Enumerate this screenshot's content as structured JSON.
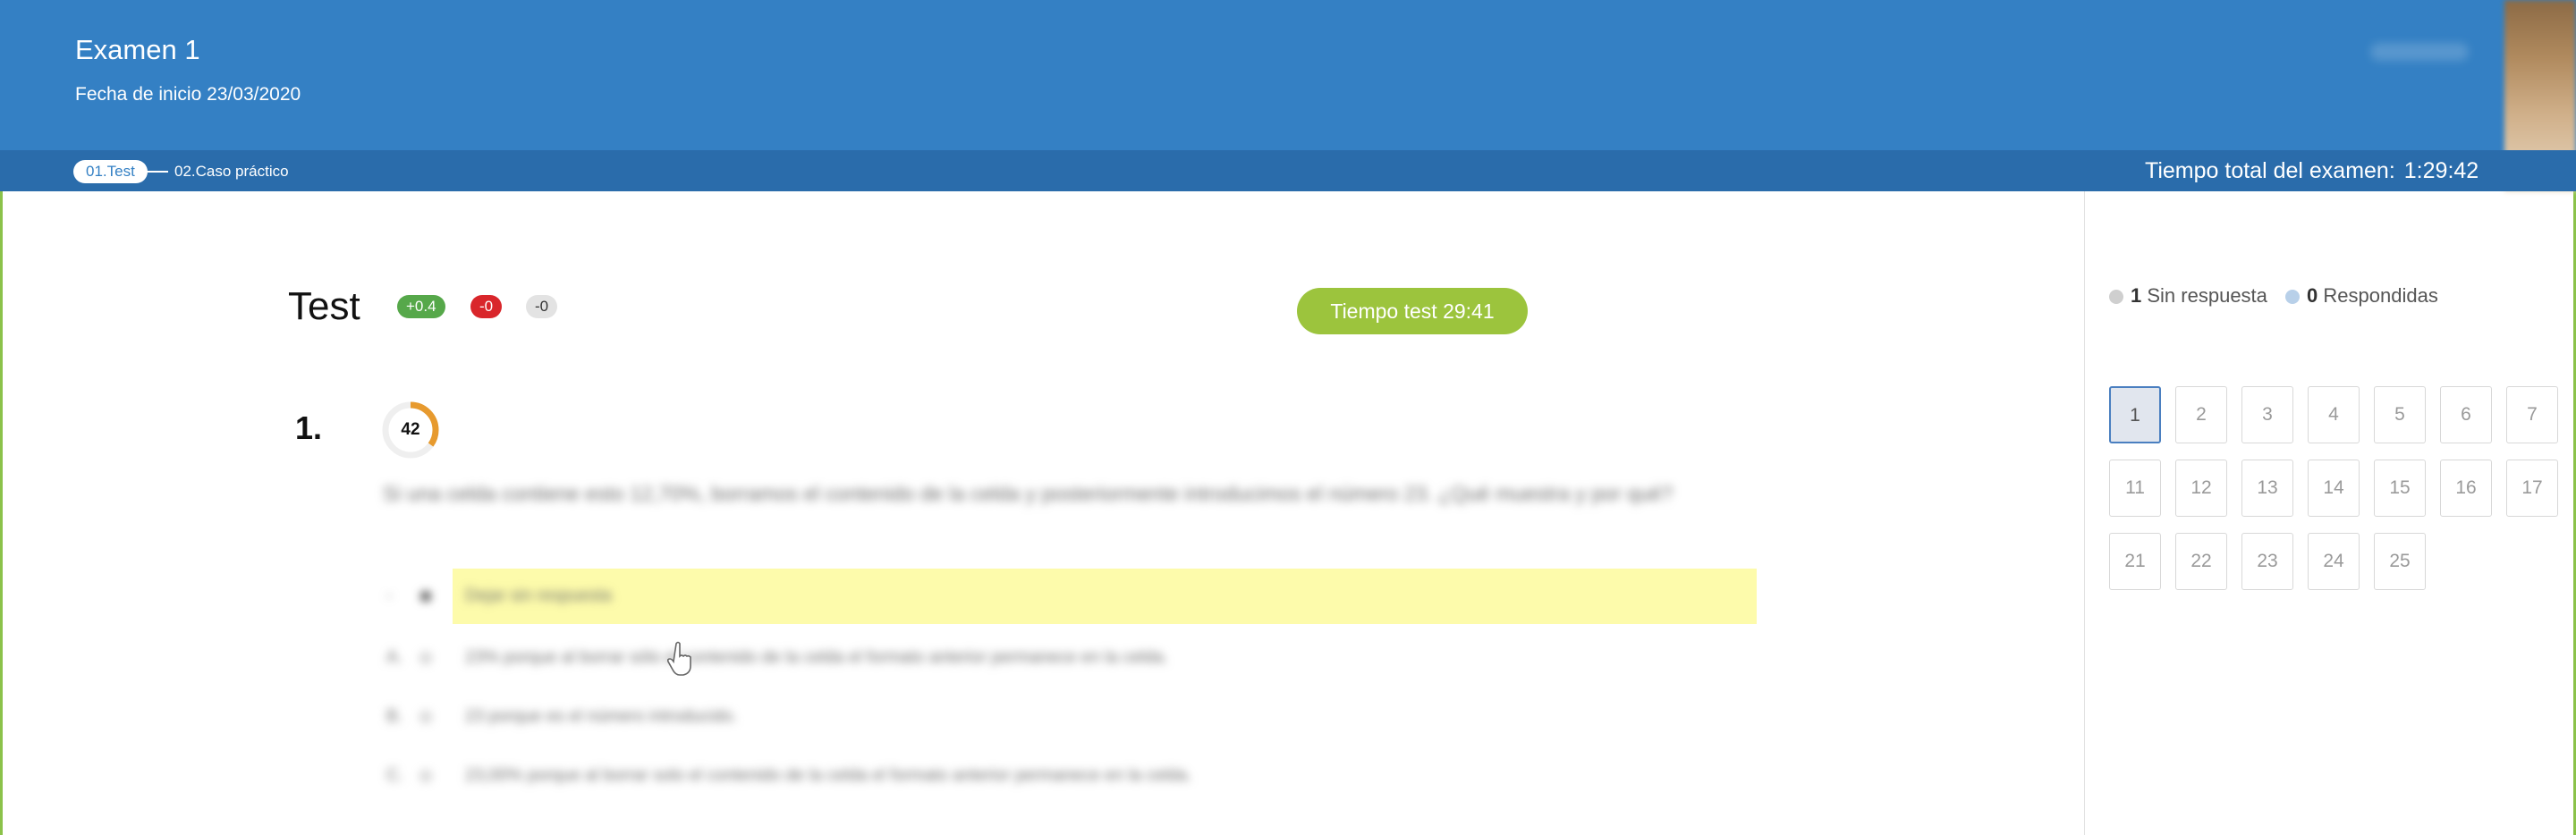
{
  "header": {
    "exam_title": "Examen 1",
    "start_date": "Fecha de inicio 23/03/2020"
  },
  "tabs": [
    {
      "label": "01.Test",
      "active": true
    },
    {
      "label": "02.Caso práctico",
      "active": false
    }
  ],
  "total_time": {
    "label": "Tiempo total del examen:",
    "value": "1:29:42"
  },
  "test": {
    "title": "Test",
    "badges": {
      "plus": "+0.4",
      "minus": "-0",
      "neutral": "-0"
    },
    "timer": "Tiempo test 29:41"
  },
  "question": {
    "number": "1.",
    "counter": "42",
    "counter_fraction": 0.35,
    "text": "Si una celda contiene esto 12,70%, borramos el contenido de la celda y posteriormente introducimos el número 23. ¿Qué muestra y por qué?",
    "answers": [
      {
        "letter": "-",
        "text": "Dejar sin respuesta",
        "selected": true
      },
      {
        "letter": "A.",
        "text": "23% porque al borrar sólo el contenido de la celda el formato anterior permanece en la celda.",
        "selected": false
      },
      {
        "letter": "B.",
        "text": "23 porque es el número introducido.",
        "selected": false
      },
      {
        "letter": "C.",
        "text": "23,00% porque al borrar solo el contenido de la celda el formato anterior permanece en la celda.",
        "selected": false
      }
    ]
  },
  "sidebar": {
    "unanswered_count": "1",
    "unanswered_label": "Sin respuesta",
    "answered_count": "0",
    "answered_label": "Respondidas",
    "questions": [
      "1",
      "2",
      "3",
      "4",
      "5",
      "6",
      "7",
      "11",
      "12",
      "13",
      "14",
      "15",
      "16",
      "17",
      "21",
      "22",
      "23",
      "24",
      "25"
    ],
    "active_question": "1"
  },
  "colors": {
    "header_bg": "#3480c4",
    "tabbar_bg": "#2a6cab",
    "timer_bg": "#9cc43d",
    "highlight": "#fdfbab",
    "counter_arc": "#e79a2e"
  }
}
